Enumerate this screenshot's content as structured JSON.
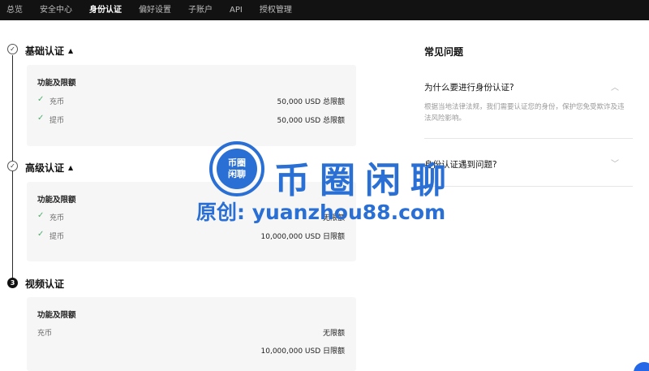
{
  "nav": {
    "items": [
      {
        "label": "总览",
        "active": false
      },
      {
        "label": "安全中心",
        "active": false
      },
      {
        "label": "身份认证",
        "active": true
      },
      {
        "label": "偏好设置",
        "active": false
      },
      {
        "label": "子账户",
        "active": false
      },
      {
        "label": "API",
        "active": false
      },
      {
        "label": "授权管理",
        "active": false
      }
    ]
  },
  "steps": [
    {
      "title": "基础认证",
      "caret": "▲",
      "marker": "✓",
      "card_head": "功能及限额",
      "rows": [
        {
          "check": "✓",
          "label": "充币",
          "value": "50,000 USD 总限额"
        },
        {
          "check": "✓",
          "label": "提币",
          "value": "50,000 USD 总限额"
        }
      ]
    },
    {
      "title": "高级认证",
      "caret": "▲",
      "marker": "✓",
      "card_head": "功能及限额",
      "rows": [
        {
          "check": "✓",
          "label": "充币",
          "value": "无限额"
        },
        {
          "check": "✓",
          "label": "提币",
          "value": "10,000,000 USD 日限额"
        }
      ]
    },
    {
      "title": "视频认证",
      "marker": "3",
      "card_head": "功能及限额",
      "rows": [
        {
          "label": "充币",
          "value": "无限额"
        },
        {
          "label": "",
          "value": "10,000,000 USD 日限额"
        }
      ]
    }
  ],
  "faq": {
    "title": "常见问题",
    "items": [
      {
        "question": "为什么要进行身份认证?",
        "answer": "根据当地法律法规，我们需要认证您的身份，保护您免受欺诈及违法风险影响。",
        "chevron": "︿"
      },
      {
        "question": "身份认证遇到问题?",
        "chevron": "﹀"
      }
    ]
  },
  "watermark": {
    "logo_line1": "币圈",
    "logo_line2": "闲聊",
    "name": "币圈闲聊",
    "url": "原创: yuanzhou88.com"
  },
  "colors": {
    "nav_bg": "#121212",
    "card_bg": "#f6f6f6",
    "check_green": "#4caf6a",
    "watermark_blue": "#2a6fd4"
  }
}
